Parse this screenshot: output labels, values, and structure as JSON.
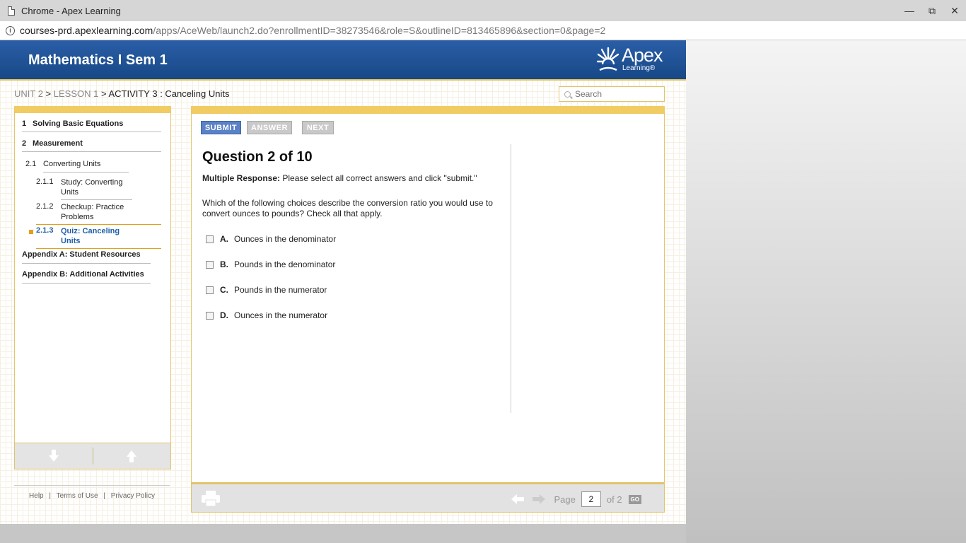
{
  "window": {
    "title": "Chrome - Apex Learning",
    "minimize": "—",
    "maximize": "⧉",
    "close": "✕"
  },
  "address_bar": {
    "host": "courses-prd.apexlearning.com",
    "path": "/apps/AceWeb/launch2.do?enrollmentID=38273546&role=S&outlineID=813465896&section=0&page=2"
  },
  "header": {
    "course_title": "Mathematics I Sem 1",
    "logo_word": "Apex",
    "logo_sub": "Learning®"
  },
  "breadcrumb": {
    "unit": "UNIT 2",
    "sep1": " > ",
    "lesson": "LESSON 1",
    "sep2": " > ",
    "activity": "ACTIVITY 3 : Canceling Units"
  },
  "search": {
    "placeholder": "Search"
  },
  "toc": [
    {
      "num": "1",
      "label": "Solving Basic Equations"
    },
    {
      "num": "2",
      "label": "Measurement"
    },
    {
      "num": "2.1",
      "label": "Converting Units"
    },
    {
      "num": "2.1.1",
      "label": "Study: Converting Units"
    },
    {
      "num": "2.1.2",
      "label": "Checkup: Practice Problems"
    },
    {
      "num": "2.1.3",
      "label": "Quiz: Canceling Units"
    },
    {
      "num": "",
      "label": "Appendix A: Student Resources"
    },
    {
      "num": "",
      "label": "Appendix B: Additional Activities"
    }
  ],
  "footer": {
    "help": "Help",
    "sep": "|",
    "terms": "Terms of Use",
    "privacy": "Privacy Policy"
  },
  "toolbar": {
    "submit": "SUBMIT",
    "answer": "ANSWER",
    "next": "NEXT"
  },
  "question": {
    "title": "Question 2 of 10",
    "type_label": "Multiple Response:",
    "instruction": " Please select all correct answers and click \"submit.\"",
    "prompt": "Which of the following choices describe the conversion ratio you would use to convert ounces to pounds? Check all that apply.",
    "choices": [
      {
        "letter": "A.",
        "text": "Ounces in the denominator"
      },
      {
        "letter": "B.",
        "text": "Pounds in the denominator"
      },
      {
        "letter": "C.",
        "text": "Pounds in the numerator"
      },
      {
        "letter": "D.",
        "text": "Ounces in the numerator"
      }
    ]
  },
  "pager": {
    "page_label": "Page",
    "current": "2",
    "of_label": "of 2",
    "go": "GO"
  },
  "colors": {
    "header_blue": "#1f56a0",
    "accent_gold": "#f1cc63",
    "active_link": "#1f5fa8",
    "submit_blue": "#5b82c8"
  }
}
